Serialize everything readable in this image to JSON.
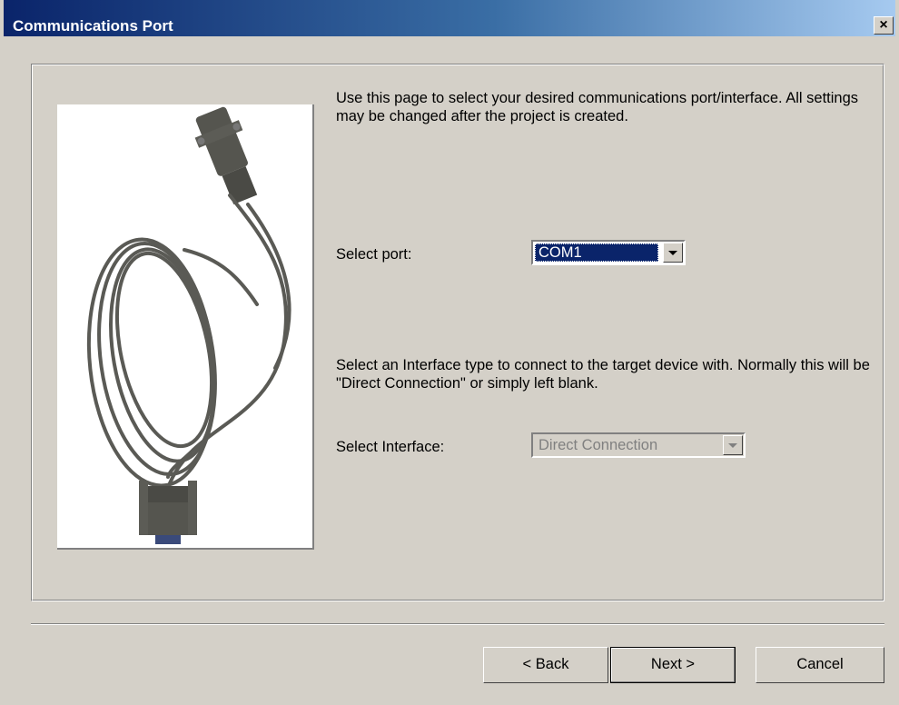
{
  "window": {
    "title": "Communications Port",
    "close_label": "×"
  },
  "intro_text": "Use this page to select your desired communications port/interface. All settings may be changed after the project is created.",
  "port": {
    "label": "Select port:",
    "selected": "COM1"
  },
  "interface": {
    "description": "Select an Interface type to connect to the target device with. Normally this will be \"Direct Connection\" or simply left blank.",
    "label": "Select Interface:",
    "selected": "Direct Connection",
    "disabled": true
  },
  "buttons": {
    "back": "< Back",
    "next": "Next >",
    "cancel": "Cancel"
  },
  "colors": {
    "titlebar_start": "#0a246a",
    "titlebar_end": "#a6caf0",
    "face": "#d4d0c8",
    "selection": "#0a246a"
  },
  "icons": {
    "picture": "serial-cable-image",
    "dropdown": "chevron-down-icon"
  }
}
